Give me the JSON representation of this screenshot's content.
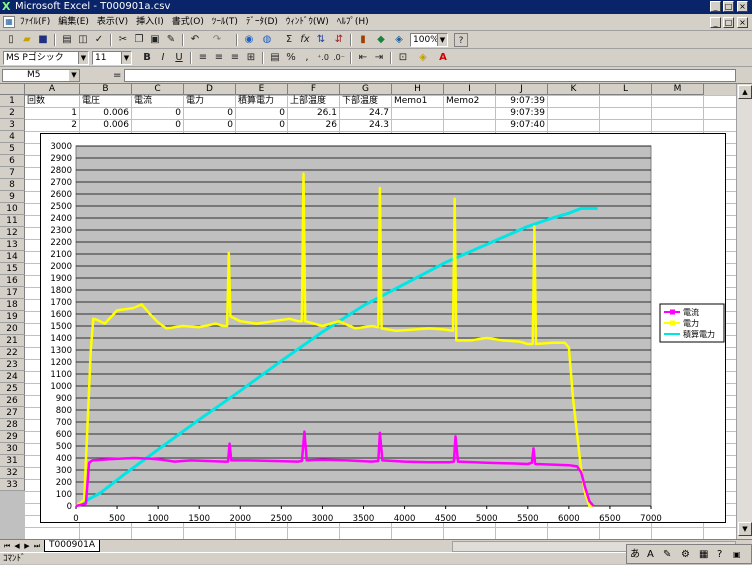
{
  "window": {
    "title": "Microsoft Excel - T000901a.csv",
    "min": "_",
    "max": "□",
    "close": "×"
  },
  "menu": [
    "ﾌｧｲﾙ(F)",
    "編集(E)",
    "表示(V)",
    "挿入(I)",
    "書式(O)",
    "ﾂｰﾙ(T)",
    "ﾃﾞｰﾀ(D)",
    "ｳｨﾝﾄﾞｳ(W)",
    "ﾍﾙﾌﾟ(H)"
  ],
  "toolbar": {
    "zoom": "100%",
    "font": "MS Pゴシック",
    "size": "11",
    "bold": "B",
    "italic": "I",
    "underline": "U",
    "sum": "Σ",
    "fx": "fx",
    "percent": "%",
    "help": "?"
  },
  "formula": {
    "cell": "M5",
    "equals": "="
  },
  "columns": [
    "A",
    "B",
    "C",
    "D",
    "E",
    "F",
    "G",
    "H",
    "I",
    "J",
    "K",
    "L",
    "M"
  ],
  "rows": [
    "1",
    "2",
    "3",
    "4",
    "5",
    "6",
    "7",
    "8",
    "9",
    "10",
    "11",
    "12",
    "13",
    "14",
    "15",
    "16",
    "17",
    "18",
    "19",
    "20",
    "21",
    "22",
    "23",
    "24",
    "25",
    "26",
    "27",
    "28",
    "29",
    "30",
    "31",
    "32",
    "33"
  ],
  "cells": {
    "headers": [
      "回数",
      "電圧",
      "電流",
      "電力",
      "積算電力",
      "上部温度",
      "下部温度",
      "Memo1",
      "Memo2",
      "9:07:39"
    ],
    "row2": [
      "1",
      "0.006",
      "0",
      "0",
      "0",
      "26.1",
      "24.7",
      "9:07:39"
    ],
    "row3": [
      "2",
      "0.006",
      "0",
      "0",
      "0",
      "26",
      "24.3",
      "9:07:40"
    ]
  },
  "sheet": {
    "tab": "T000901A"
  },
  "status": {
    "text": "ｺﾏﾝﾄﾞ"
  },
  "colors": {
    "current": "#ff00ff",
    "power": "#ffff00",
    "energy": "#00e5e5",
    "plot_bg": "#c0c0c0"
  },
  "chart_data": {
    "type": "line",
    "xlim": [
      0,
      7000
    ],
    "ylim": [
      0,
      3000
    ],
    "xticks": [
      "0",
      "500",
      "1000",
      "1500",
      "2000",
      "2500",
      "3000",
      "3500",
      "4000",
      "4500",
      "5000",
      "5500",
      "6000",
      "6500",
      "7000"
    ],
    "yticks": [
      "0",
      "100",
      "200",
      "300",
      "400",
      "500",
      "600",
      "700",
      "800",
      "900",
      "1000",
      "1100",
      "1200",
      "1300",
      "1400",
      "1500",
      "1600",
      "1700",
      "1800",
      "1900",
      "2000",
      "2100",
      "2200",
      "2300",
      "2400",
      "2500",
      "2600",
      "2700",
      "2800",
      "2900",
      "3000"
    ],
    "legend_position": "right",
    "series": [
      {
        "name": "電流",
        "color": "#ff00ff",
        "points": [
          [
            0,
            0
          ],
          [
            120,
            20
          ],
          [
            160,
            360
          ],
          [
            200,
            380
          ],
          [
            400,
            390
          ],
          [
            700,
            400
          ],
          [
            900,
            395
          ],
          [
            1050,
            385
          ],
          [
            1200,
            370
          ],
          [
            1400,
            380
          ],
          [
            1600,
            375
          ],
          [
            1800,
            370
          ],
          [
            1850,
            370
          ],
          [
            1870,
            520
          ],
          [
            1890,
            380
          ],
          [
            2100,
            380
          ],
          [
            2400,
            375
          ],
          [
            2700,
            370
          ],
          [
            2750,
            375
          ],
          [
            2780,
            620
          ],
          [
            2810,
            380
          ],
          [
            3000,
            385
          ],
          [
            3300,
            380
          ],
          [
            3600,
            370
          ],
          [
            3680,
            375
          ],
          [
            3700,
            610
          ],
          [
            3730,
            380
          ],
          [
            4000,
            370
          ],
          [
            4300,
            365
          ],
          [
            4550,
            365
          ],
          [
            4600,
            370
          ],
          [
            4620,
            580
          ],
          [
            4650,
            370
          ],
          [
            5000,
            360
          ],
          [
            5300,
            355
          ],
          [
            5500,
            350
          ],
          [
            5550,
            360
          ],
          [
            5570,
            480
          ],
          [
            5590,
            350
          ],
          [
            5800,
            345
          ],
          [
            6000,
            340
          ],
          [
            6100,
            330
          ],
          [
            6150,
            280
          ],
          [
            6200,
            150
          ],
          [
            6250,
            40
          ],
          [
            6300,
            0
          ]
        ]
      },
      {
        "name": "電力",
        "color": "#ffff00",
        "points": [
          [
            0,
            0
          ],
          [
            100,
            50
          ],
          [
            180,
            1300
          ],
          [
            210,
            1560
          ],
          [
            260,
            1550
          ],
          [
            350,
            1520
          ],
          [
            500,
            1630
          ],
          [
            700,
            1650
          ],
          [
            800,
            1680
          ],
          [
            900,
            1600
          ],
          [
            1000,
            1530
          ],
          [
            1100,
            1480
          ],
          [
            1300,
            1500
          ],
          [
            1500,
            1490
          ],
          [
            1700,
            1520
          ],
          [
            1800,
            1500
          ],
          [
            1840,
            1500
          ],
          [
            1860,
            2110
          ],
          [
            1880,
            1580
          ],
          [
            2000,
            1540
          ],
          [
            2200,
            1520
          ],
          [
            2400,
            1540
          ],
          [
            2600,
            1560
          ],
          [
            2700,
            1540
          ],
          [
            2750,
            1540
          ],
          [
            2770,
            2770
          ],
          [
            2790,
            1540
          ],
          [
            3000,
            1500
          ],
          [
            3200,
            1540
          ],
          [
            3400,
            1480
          ],
          [
            3600,
            1500
          ],
          [
            3680,
            1490
          ],
          [
            3700,
            2650
          ],
          [
            3720,
            1480
          ],
          [
            3900,
            1460
          ],
          [
            4100,
            1470
          ],
          [
            4300,
            1480
          ],
          [
            4500,
            1470
          ],
          [
            4590,
            1460
          ],
          [
            4610,
            2560
          ],
          [
            4630,
            1380
          ],
          [
            4800,
            1380
          ],
          [
            5000,
            1400
          ],
          [
            5200,
            1380
          ],
          [
            5400,
            1370
          ],
          [
            5500,
            1350
          ],
          [
            5560,
            1350
          ],
          [
            5580,
            2330
          ],
          [
            5600,
            1350
          ],
          [
            5800,
            1360
          ],
          [
            5950,
            1360
          ],
          [
            6000,
            1320
          ],
          [
            6050,
            900
          ],
          [
            6100,
            600
          ],
          [
            6150,
            300
          ],
          [
            6200,
            100
          ],
          [
            6250,
            0
          ],
          [
            6300,
            0
          ]
        ]
      },
      {
        "name": "積算電力",
        "color": "#00e5e5",
        "points": [
          [
            0,
            0
          ],
          [
            300,
            110
          ],
          [
            600,
            270
          ],
          [
            1000,
            470
          ],
          [
            1500,
            720
          ],
          [
            2000,
            960
          ],
          [
            2500,
            1210
          ],
          [
            3000,
            1450
          ],
          [
            3500,
            1670
          ],
          [
            4000,
            1850
          ],
          [
            4500,
            2030
          ],
          [
            5000,
            2180
          ],
          [
            5500,
            2330
          ],
          [
            5800,
            2400
          ],
          [
            6000,
            2440
          ],
          [
            6150,
            2480
          ],
          [
            6350,
            2480
          ]
        ]
      }
    ]
  }
}
